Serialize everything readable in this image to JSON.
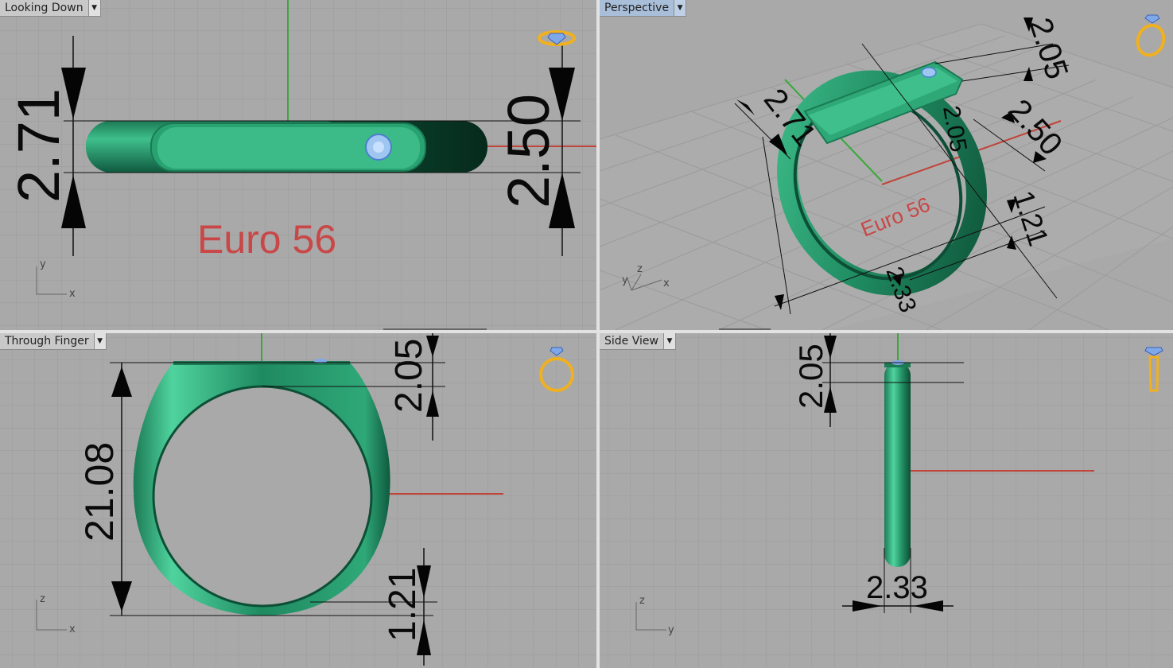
{
  "viewports": {
    "top_left": {
      "label": "Looking Down",
      "active": false
    },
    "top_right": {
      "label": "Perspective",
      "active": true
    },
    "bottom_left": {
      "label": "Through Finger",
      "active": false
    },
    "bottom_right": {
      "label": "Side View",
      "active": false
    }
  },
  "dims": {
    "d271": "2.71",
    "d250": "2.50",
    "d205": "2.05",
    "d2108": "21.08",
    "d121": "1.21",
    "d233": "2.33"
  },
  "size_label": "Euro 56",
  "axes": {
    "top": {
      "v": "y",
      "h": "x"
    },
    "front": {
      "v": "z",
      "h": "x"
    },
    "right": {
      "v": "z",
      "h": "y"
    },
    "persp": {
      "y": "y",
      "z": "z",
      "x": "x"
    }
  },
  "icons": {
    "top_left": "ring-top-icon",
    "top_right": "ring-perspective-icon",
    "bottom_left": "ring-front-icon",
    "bottom_right": "ring-side-icon"
  },
  "colors": {
    "viewport_bg": "#a9a9a9",
    "grid": "#989898",
    "ring_green": "#2fa878",
    "ring_dark": "#0f5a3f",
    "x_axis": "#c0443a",
    "y_axis": "#3aa83a",
    "active_label": "#a9bfd9",
    "icon_gold": "#f0b020"
  }
}
